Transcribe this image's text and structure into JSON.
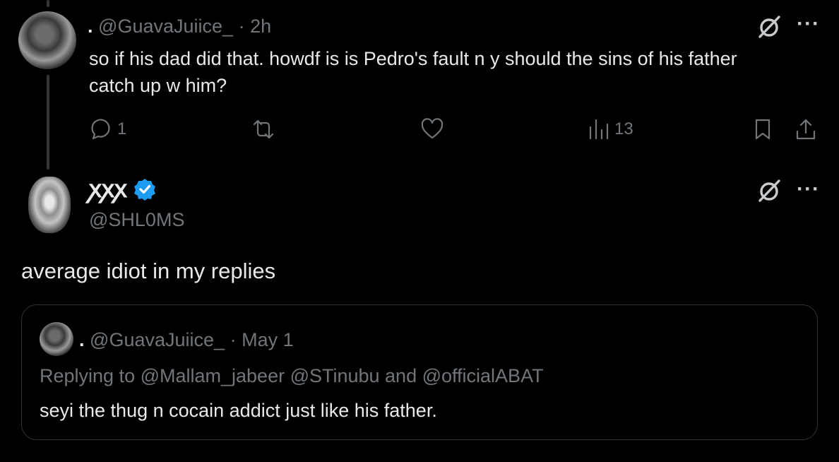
{
  "reply_tweet": {
    "display_name": ".",
    "handle": "@GuavaJuiice_",
    "separator": "·",
    "time": "2h",
    "text": "so if his dad did that. howdf is is Pedro's fault n y should the sins of his father catch up w him?",
    "actions": {
      "reply_count": "1",
      "retweet_count": "",
      "like_count": "",
      "views_count": "13"
    },
    "icons": [
      "grok-icon",
      "more-icon",
      "reply-icon",
      "retweet-icon",
      "like-icon",
      "views-icon",
      "bookmark-icon",
      "share-icon"
    ]
  },
  "main_tweet": {
    "display_name": "ꭗꭗꭗ",
    "verified": true,
    "verified_color": "#1d9bf0",
    "handle": "@SHL0MS",
    "text": "average idiot in my replies"
  },
  "quoted_tweet": {
    "display_name": ".",
    "handle": "@GuavaJuiice_",
    "separator": "·",
    "date": "May 1",
    "replying_to": "Replying to @Mallam_jabeer @STinubu and @officialABAT",
    "text": "seyi the thug n cocain addict just like his father."
  },
  "colors": {
    "background": "#000000",
    "text": "#e7e9ea",
    "muted": "#71767b",
    "border": "#2f3336"
  }
}
